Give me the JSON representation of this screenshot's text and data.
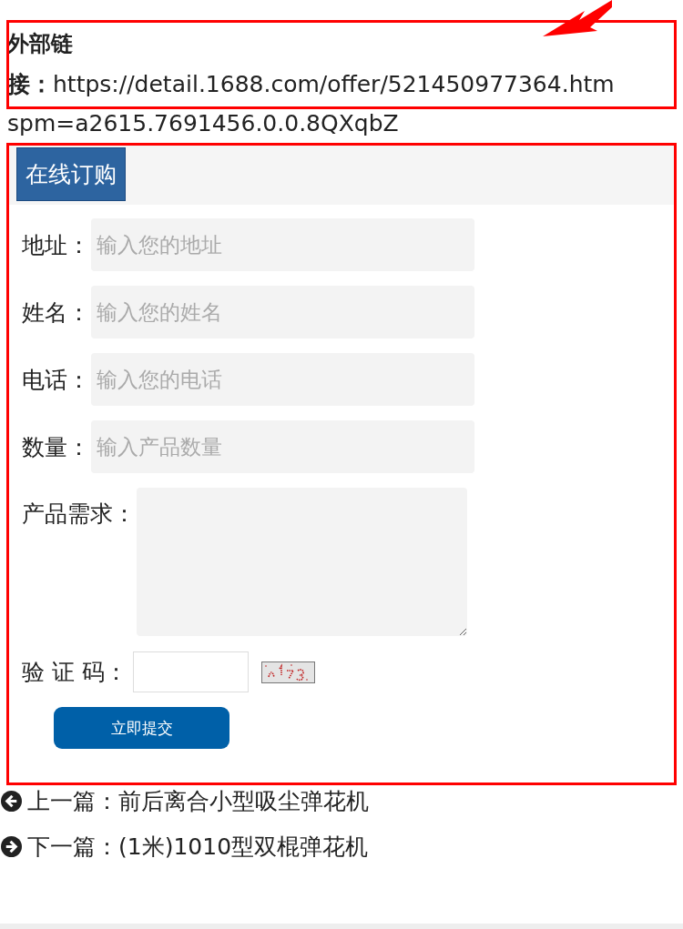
{
  "external_link": {
    "label": "外部链",
    "lines": [
      "**接：**https://detail.1688.com/offer/521450977364.htm",
      "spm=a2615.7691456.0.0.8QXqbZ"
    ]
  },
  "order_form": {
    "title": "在线订购",
    "fields": [
      {
        "label": "地址：",
        "placeholder": "输入您的地址",
        "kind": "input"
      },
      {
        "label": "姓名：",
        "placeholder": "输入您的姓名",
        "kind": "input"
      },
      {
        "label": "电话：",
        "placeholder": "输入您的电话",
        "kind": "input"
      },
      {
        "label": "数量：",
        "placeholder": "输入产品数量",
        "kind": "input"
      },
      {
        "label": "产品需求：",
        "kind": "textarea"
      }
    ],
    "captcha": {
      "label": "验 证 码："
    },
    "submit": "立即提交"
  },
  "navigation": [
    {
      "kind": "previous",
      "text": "上一篇：前后离合小型吸尘弹花机"
    },
    {
      "kind": "next",
      "text": "下一篇：(1米)1010型双棍弹花机"
    }
  ]
}
